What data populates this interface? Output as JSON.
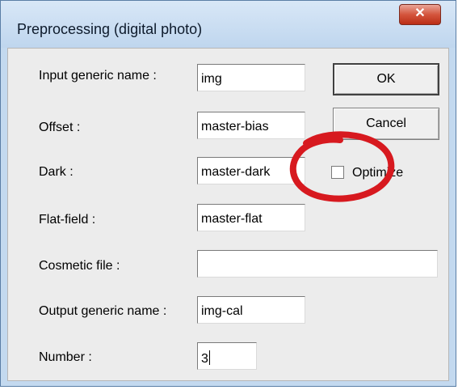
{
  "window": {
    "title": "Preprocessing (digital photo)",
    "close_glyph": "✕"
  },
  "fields": {
    "input_generic_name": {
      "label": "Input generic name :",
      "value": "img"
    },
    "offset": {
      "label": "Offset :",
      "value": "master-bias"
    },
    "dark": {
      "label": "Dark :",
      "value": "master-dark"
    },
    "flat_field": {
      "label": "Flat-field :",
      "value": "master-flat"
    },
    "cosmetic_file": {
      "label": "Cosmetic file :",
      "value": ""
    },
    "output_generic_name": {
      "label": "Output generic name :",
      "value": "img-cal"
    },
    "number": {
      "label": "Number :",
      "value": "3"
    }
  },
  "buttons": {
    "ok": "OK",
    "cancel": "Cancel"
  },
  "optimize": {
    "label": "Optimize",
    "checked": false
  },
  "colors": {
    "annotation_circle": "#d7191f",
    "close_button": "#c8472f"
  }
}
